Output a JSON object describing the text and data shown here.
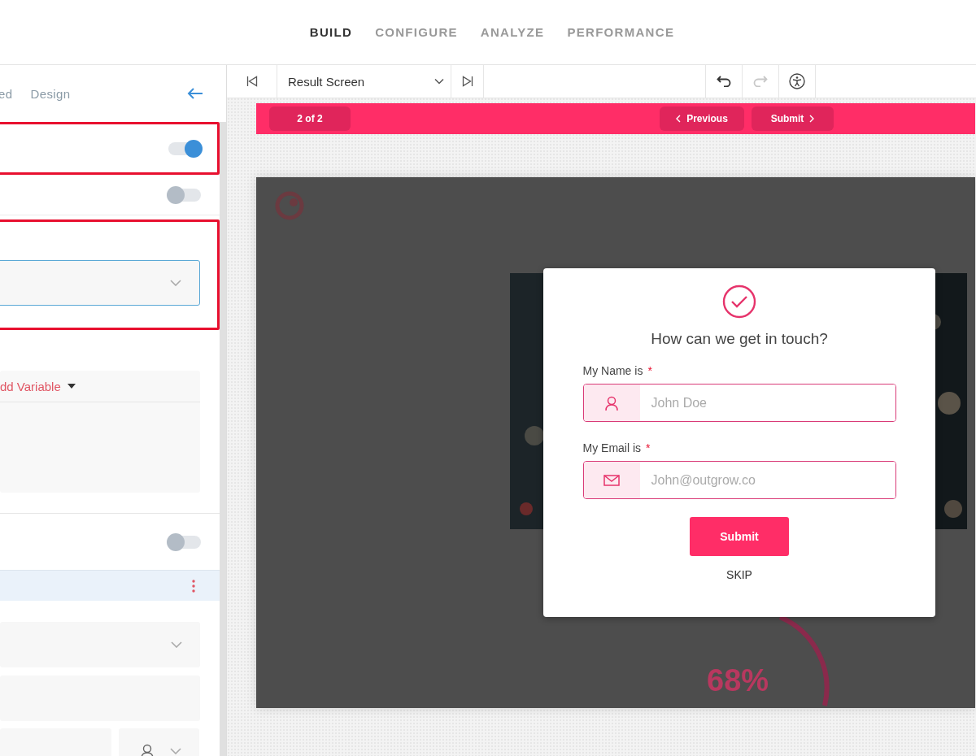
{
  "top_nav": {
    "tabs": [
      {
        "label": "BUILD",
        "selected": true
      },
      {
        "label": "CONFIGURE",
        "selected": false
      },
      {
        "label": "ANALYZE",
        "selected": false
      },
      {
        "label": "PERFORMANCE",
        "selected": false
      }
    ]
  },
  "side_panel": {
    "tabs": [
      {
        "label": "ed",
        "selected": false
      },
      {
        "label": "Design",
        "selected": false
      }
    ],
    "toggle_1": {
      "on": true
    },
    "toggle_2": {
      "on": false
    },
    "variable_menu": {
      "label": "dd Variable"
    },
    "toggle_3": {
      "on": false
    }
  },
  "toolbar": {
    "screen_select": {
      "value": "Result Screen"
    },
    "undo": {
      "disabled": false
    },
    "redo": {
      "disabled": true
    }
  },
  "nav_bar": {
    "page_count": "2 of 2",
    "previous": "Previous",
    "submit": "Submit"
  },
  "preview": {
    "result_value": "68%",
    "form": {
      "title": "How can we get in touch?",
      "fields": [
        {
          "kind": "name",
          "label": "My Name is",
          "required_mark": "*",
          "placeholder": "John Doe"
        },
        {
          "kind": "email",
          "label": "My Email is",
          "required_mark": "*",
          "placeholder": "John@outgrow.co"
        }
      ],
      "submit": "Submit",
      "skip": "SKIP"
    }
  }
}
